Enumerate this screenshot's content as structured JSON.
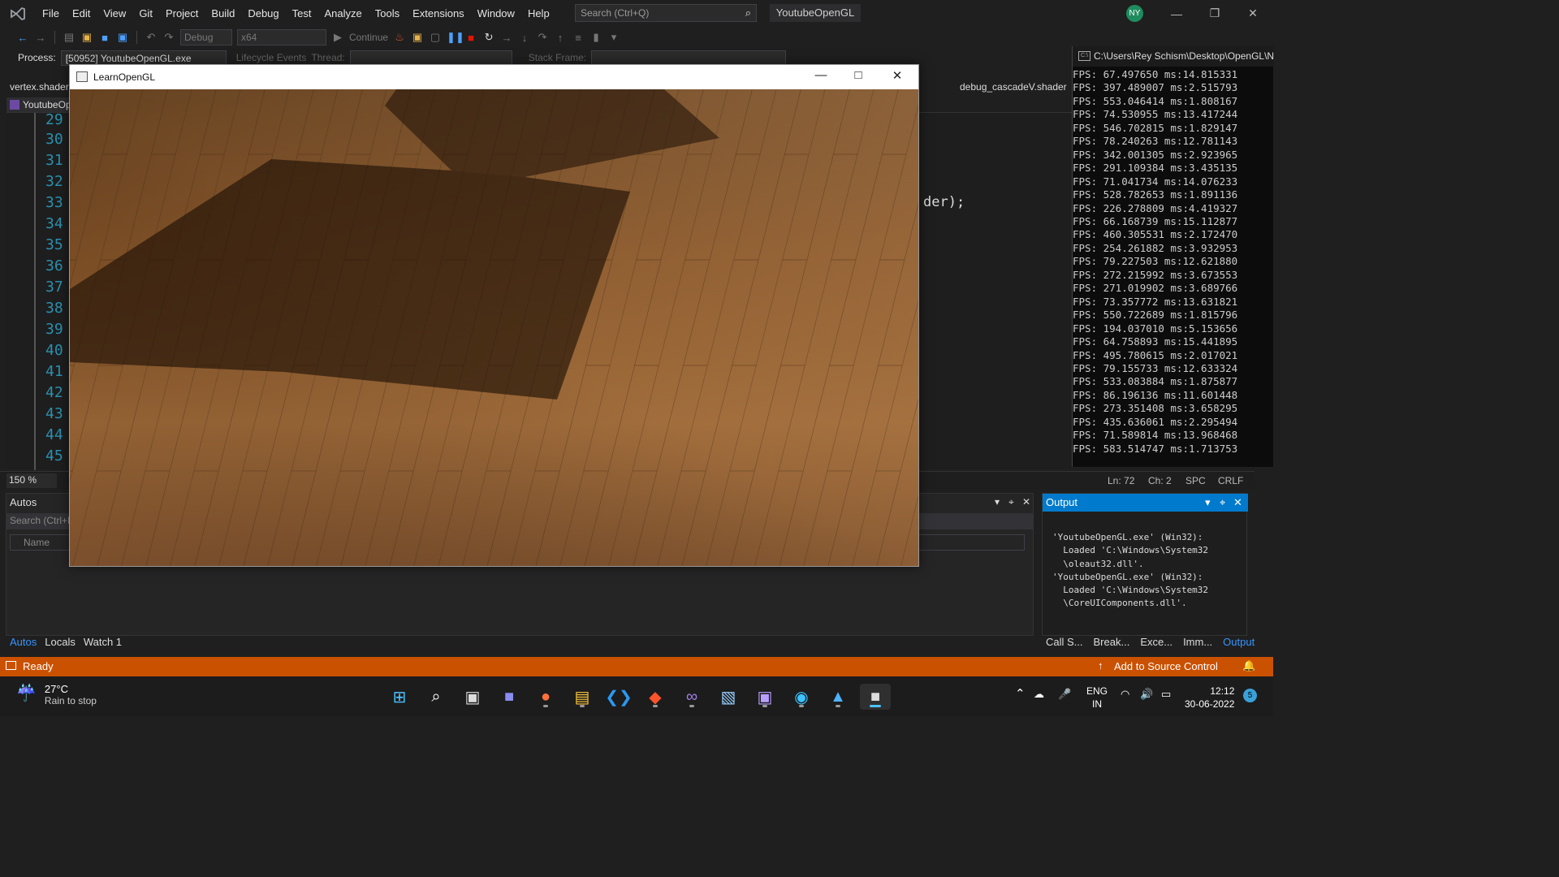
{
  "menubar": {
    "items": [
      "File",
      "Edit",
      "View",
      "Git",
      "Project",
      "Build",
      "Debug",
      "Test",
      "Analyze",
      "Tools",
      "Extensions",
      "Window",
      "Help"
    ],
    "search_placeholder": "Search (Ctrl+Q)",
    "solution_name": "YoutubeOpenGL",
    "user_initials": "NY"
  },
  "toolbar": {
    "config": "Debug",
    "platform": "x64",
    "continue_label": "Continue"
  },
  "debugbar": {
    "process_label": "Process:",
    "process_value": "[50952] YoutubeOpenGL.exe",
    "lifecycle_label": "Lifecycle Events",
    "thread_label": "Thread:",
    "stack_label": "Stack Frame:"
  },
  "editor": {
    "left_doc_tab": "vertex.shader",
    "right_doc_tab": "debug_cascadeV.shader",
    "file_tab": "YoutubeOp",
    "line_numbers": [
      "29",
      "30",
      "31",
      "32",
      "33",
      "34",
      "35",
      "36",
      "37",
      "38",
      "39",
      "40",
      "41",
      "42",
      "43",
      "44",
      "45"
    ],
    "code_fragment": "der);",
    "zoom": "150 %",
    "ln": "Ln: 72",
    "ch": "Ch: 2",
    "spc": "SPC",
    "crlf": "CRLF"
  },
  "autos": {
    "title": "Autos",
    "search_placeholder": "Search (Ctrl+E)",
    "name_header": "Name",
    "tabs": [
      "Autos",
      "Locals",
      "Watch 1"
    ]
  },
  "output": {
    "title": "Output",
    "text": "'YoutubeOpenGL.exe' (Win32):\n  Loaded 'C:\\Windows\\System32\n  \\oleaut32.dll'.\n'YoutubeOpenGL.exe' (Win32):\n  Loaded 'C:\\Windows\\System32\n  \\CoreUIComponents.dll'.",
    "tabs": [
      "Call S...",
      "Break...",
      "Exce...",
      "Imm...",
      "Output"
    ]
  },
  "statusbar": {
    "ready": "Ready",
    "source_control": "Add to Source Control"
  },
  "console": {
    "title": "C:\\Users\\Rey Schism\\Desktop\\OpenGL\\N",
    "lines": [
      "FPS: 67.497650 ms:14.815331",
      "FPS: 397.489007 ms:2.515793",
      "FPS: 553.046414 ms:1.808167",
      "FPS: 74.530955 ms:13.417244",
      "FPS: 546.702815 ms:1.829147",
      "FPS: 78.240263 ms:12.781143",
      "FPS: 342.001305 ms:2.923965",
      "FPS: 291.109384 ms:3.435135",
      "FPS: 71.041734 ms:14.076233",
      "FPS: 528.782653 ms:1.891136",
      "FPS: 226.278809 ms:4.419327",
      "FPS: 66.168739 ms:15.112877",
      "FPS: 460.305531 ms:2.172470",
      "FPS: 254.261882 ms:3.932953",
      "FPS: 79.227503 ms:12.621880",
      "FPS: 272.215992 ms:3.673553",
      "FPS: 271.019902 ms:3.689766",
      "FPS: 73.357772 ms:13.631821",
      "FPS: 550.722689 ms:1.815796",
      "FPS: 194.037010 ms:5.153656",
      "FPS: 64.758893 ms:15.441895",
      "FPS: 495.780615 ms:2.017021",
      "FPS: 79.155733 ms:12.633324",
      "FPS: 533.083884 ms:1.875877",
      "FPS: 86.196136 ms:11.601448",
      "FPS: 273.351408 ms:3.658295",
      "FPS: 435.636061 ms:2.295494",
      "FPS: 71.589814 ms:13.968468",
      "FPS: 583.514747 ms:1.713753"
    ]
  },
  "glwindow": {
    "title": "LearnOpenGL"
  },
  "taskbar": {
    "temperature": "27°C",
    "weather": "Rain to stop",
    "lang": "ENG",
    "region": "IN",
    "time": "12:12",
    "date": "30-06-2022",
    "notification_count": "5",
    "apps": [
      "windows-start-icon",
      "search-icon",
      "task-view-icon",
      "chat-icon",
      "firefox-icon",
      "file-explorer-icon",
      "vscode-icon",
      "brave-icon",
      "visual-studio-icon",
      "image-viewer-icon",
      "terminal-icon",
      "browser-icon",
      "photos-icon",
      "opengl-app-icon"
    ]
  }
}
